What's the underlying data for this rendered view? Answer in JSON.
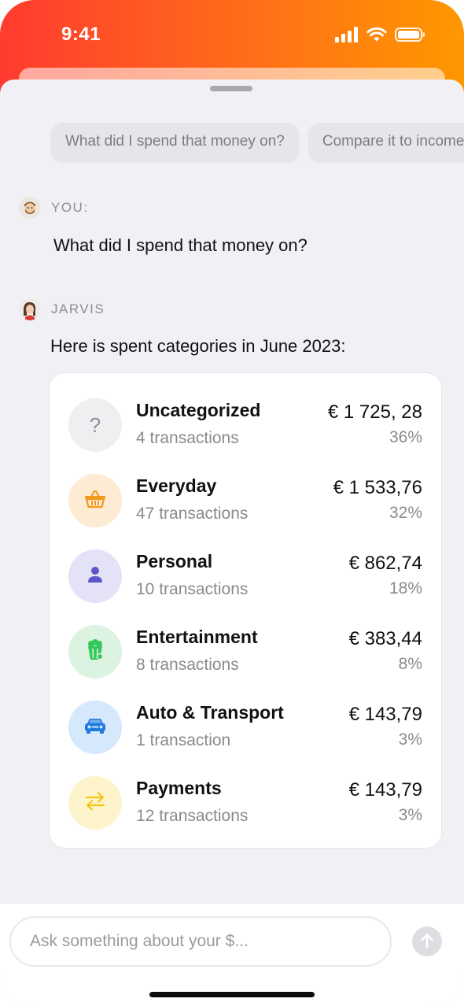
{
  "status_bar": {
    "time": "9:41"
  },
  "suggestions": [
    {
      "label": "What did I spend that money on?"
    },
    {
      "label": "Compare it to income"
    }
  ],
  "user_message": {
    "sender": "YOU:",
    "text": "What did I spend that money on?"
  },
  "assistant_message": {
    "sender": "JARVIS",
    "text": "Here is spent categories in June 2023:"
  },
  "categories": [
    {
      "name": "Uncategorized",
      "count": "4 transactions",
      "amount": "€ 1 725, 28",
      "percent": "36%",
      "icon": "question-icon",
      "bg": "#efeff2",
      "color": "#8e8e93"
    },
    {
      "name": "Everyday",
      "count": "47 transactions",
      "amount": "€ 1 533,76",
      "percent": "32%",
      "icon": "basket-icon",
      "bg": "#fdebd3",
      "color": "#f29a1c"
    },
    {
      "name": "Personal",
      "count": "10 transactions",
      "amount": "€ 862,74",
      "percent": "18%",
      "icon": "person-icon",
      "bg": "#e4e2f7",
      "color": "#5e56c8"
    },
    {
      "name": "Entertainment",
      "count": "8 transactions",
      "amount": "€ 383,44",
      "percent": "8%",
      "icon": "popcorn-icon",
      "bg": "#dcf3e1",
      "color": "#34c759"
    },
    {
      "name": "Auto & Transport",
      "count": "1 transaction",
      "amount": "€ 143,79",
      "percent": "3%",
      "icon": "car-icon",
      "bg": "#d6e8fb",
      "color": "#1f7ae0"
    },
    {
      "name": "Payments",
      "count": "12 transactions",
      "amount": "€ 143,79",
      "percent": "3%",
      "icon": "arrows-exchange-icon",
      "bg": "#fdf4cc",
      "color": "#f3c614"
    }
  ],
  "composer": {
    "placeholder": "Ask something about your $..."
  }
}
